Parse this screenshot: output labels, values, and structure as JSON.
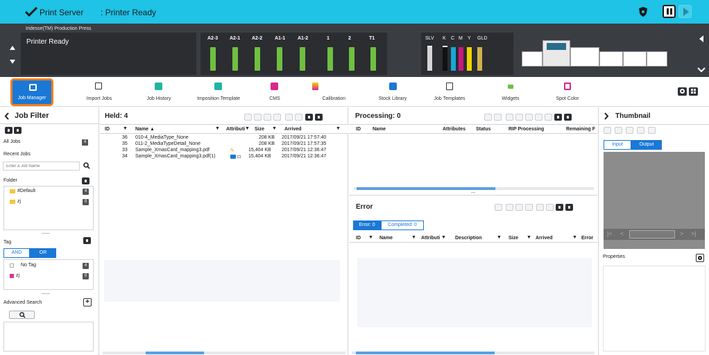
{
  "topbar": {
    "app": "Print Server",
    "status": ": Printer Ready"
  },
  "printer": {
    "model": "Iridesse(TM) Production Press",
    "state": "Printer Ready",
    "trays": [
      "A2-3",
      "A2-1",
      "A2-2",
      "A1-1",
      "A1-2",
      "1",
      "2",
      "T1"
    ],
    "inks": [
      "SLV",
      "K",
      "C",
      "M",
      "Y",
      "GLD"
    ]
  },
  "toolbar": [
    "Job Manager",
    "Import Jobs",
    "Job History",
    "Imposition Template",
    "CMS",
    "Calibration",
    "Stock Library",
    "Job Templates",
    "Widgets",
    "Spot Color"
  ],
  "filter": {
    "title": "Job Filter",
    "all_jobs": "All Jobs",
    "all_count": "4",
    "recent": "Recent Jobs",
    "search_placeholder": "Enter a Job Name",
    "folder": "Folder",
    "folders": [
      {
        "name": "#Default",
        "count": "4"
      },
      {
        "name": "zj",
        "count": "0"
      }
    ],
    "tag": "Tag",
    "and": "AND",
    "or": "OR",
    "tags": [
      {
        "name": "No Tag",
        "count": "4"
      },
      {
        "name": "zj",
        "count": "0"
      }
    ],
    "advanced": "Advanced Search"
  },
  "held": {
    "title": "Held: 4",
    "cols": [
      "ID",
      "Name ▲",
      "Attributi",
      "Size",
      "Arrived"
    ],
    "rows": [
      {
        "id": "36",
        "name": "010-4_MediaType_None",
        "size": "208 KB",
        "arrived": "2017/09/21 17:57:40"
      },
      {
        "id": "35",
        "name": "011-2_MediaTypeDetail_None",
        "size": "208 KB",
        "arrived": "2017/09/21 17:57:35"
      },
      {
        "id": "33",
        "name": "Sample_XmasCard_mapping3.pdf",
        "size": "15,404 KB",
        "arrived": "2017/09/21 12:36:47"
      },
      {
        "id": "34",
        "name": "Sample_XmasCard_mapping3.pdf(1)",
        "size": "15,404 KB",
        "arrived": "2017/09/21 12:36:47"
      }
    ]
  },
  "processing": {
    "title": "Processing: 0",
    "cols": [
      "ID",
      "Name",
      "Attributes",
      "Status",
      "RIP Processing",
      "Remaining F"
    ]
  },
  "error": {
    "title": "Error",
    "tab_error": "Error: 0",
    "tab_completed": "Completed: 0",
    "cols": [
      "ID",
      "Name",
      "Attributi",
      "Description",
      "Size",
      "Arrived",
      "Error"
    ]
  },
  "thumbnail": {
    "title": "Thumbnail",
    "input": "Input",
    "output": "Output",
    "properties": "Properties"
  },
  "colors": {
    "accent": "#1a78d6",
    "topbar": "#1ec3e6",
    "highlight": "#f07d1a",
    "dark": "#2d3136",
    "tag_pink": "#e0309a",
    "folder_yellow": "#f4c542"
  }
}
